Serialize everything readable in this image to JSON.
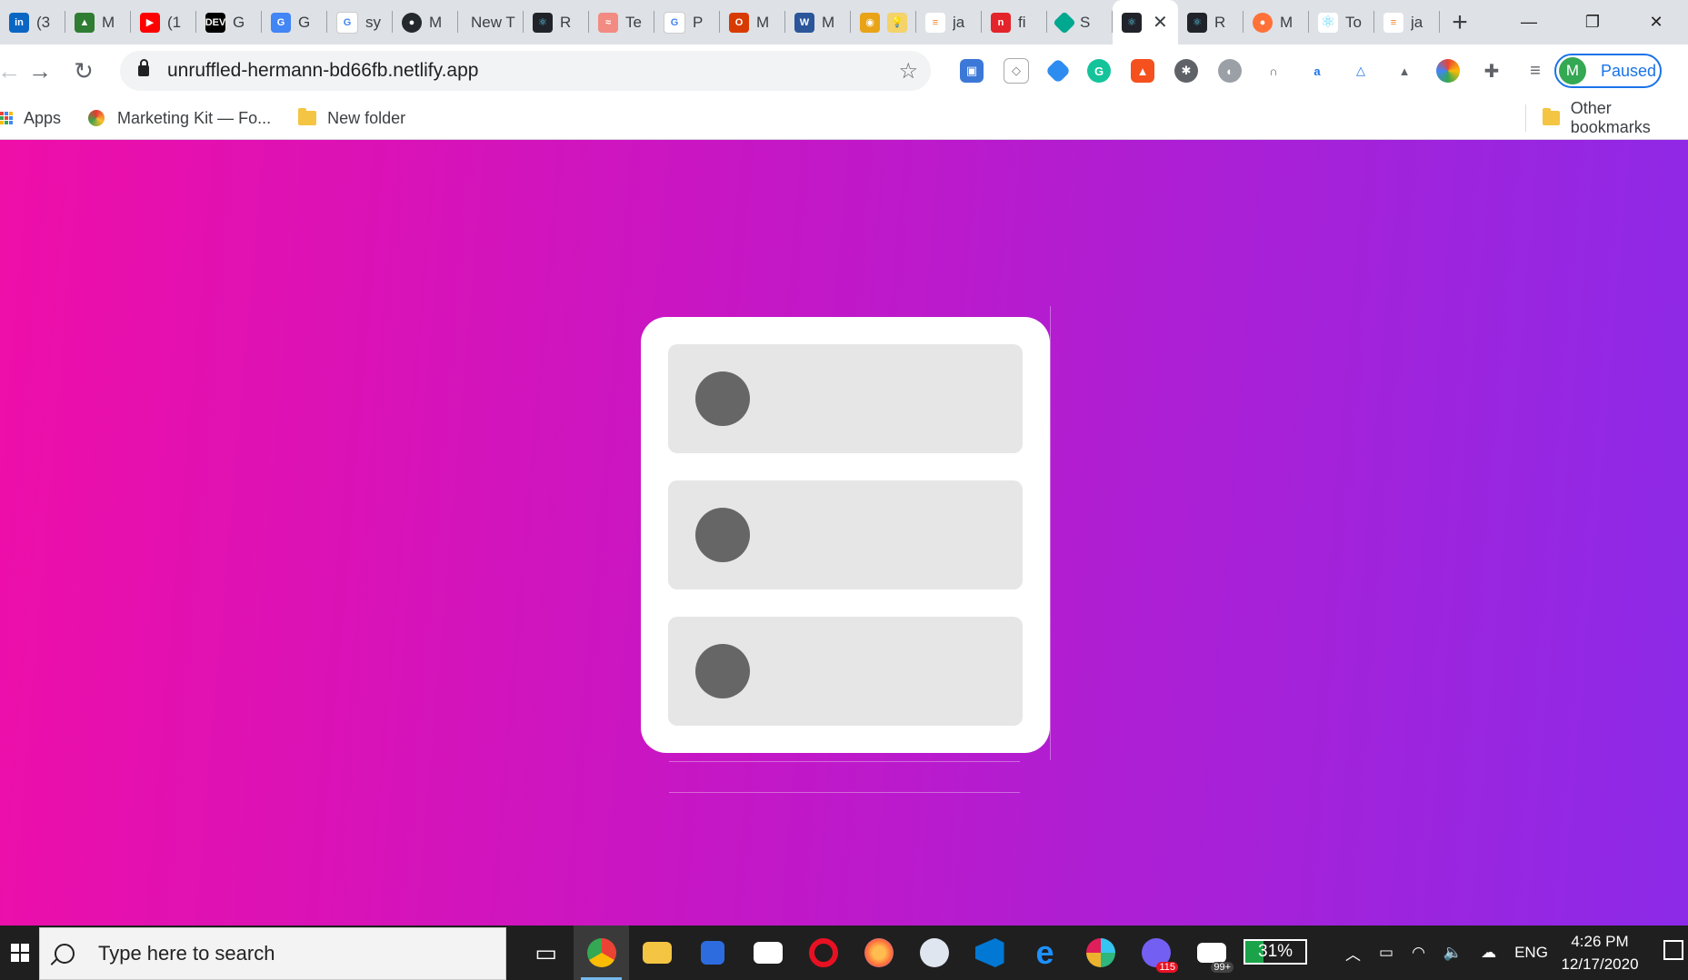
{
  "browser": {
    "tabs": [
      {
        "label": "(3",
        "icon": "linkedin-icon",
        "color": "#0a66c2"
      },
      {
        "label": "M",
        "icon": "tree-icon",
        "color": "#2e7d32"
      },
      {
        "label": "(1",
        "icon": "youtube-icon",
        "color": "#ff0000"
      },
      {
        "label": "G",
        "icon": "dev-icon",
        "color": "#000000"
      },
      {
        "label": "G",
        "icon": "google-translate-icon",
        "color": "#4285f4"
      },
      {
        "label": "sy",
        "icon": "google-icon",
        "color": "#4285f4"
      },
      {
        "label": "M",
        "icon": "github-icon",
        "color": "#24292e"
      },
      {
        "label": "New T",
        "icon": "",
        "color": ""
      },
      {
        "label": "R",
        "icon": "react-icon",
        "color": "#20232a"
      },
      {
        "label": "Te",
        "icon": "wave-icon",
        "color": "#f28b82"
      },
      {
        "label": "P",
        "icon": "google-icon",
        "color": "#4285f4"
      },
      {
        "label": "M",
        "icon": "office-icon",
        "color": "#d83b01"
      },
      {
        "label": "M",
        "icon": "word-icon",
        "color": "#2b579a"
      },
      {
        "label": "",
        "icon": "badge-icon",
        "color": "#e8a317"
      },
      {
        "label": "ja",
        "icon": "stackoverflow-icon",
        "color": "#f48024"
      },
      {
        "label": "fi",
        "icon": "netlify-n-icon",
        "color": "#e3242b"
      },
      {
        "label": "S",
        "icon": "diamond-icon",
        "color": "#00a88f"
      },
      {
        "label": "",
        "icon": "react-icon",
        "color": "#20232a",
        "active": true
      },
      {
        "label": "R",
        "icon": "react-icon",
        "color": "#20232a"
      },
      {
        "label": "M",
        "icon": "firefox-icon",
        "color": "#ff7139"
      },
      {
        "label": "To",
        "icon": "react-icon",
        "color": "#61dafb"
      },
      {
        "label": "ja",
        "icon": "stackoverflow-icon",
        "color": "#f48024"
      }
    ],
    "new_tab_symbol": "+",
    "window_controls": {
      "minimize": "—",
      "restore": "❐",
      "close": "✕"
    },
    "nav": {
      "back": "←",
      "forward": "→",
      "reload": "↻"
    },
    "url": "unruffled-hermann-bd66fb.netlify.app",
    "star_symbol": "☆",
    "profile": {
      "initial": "M",
      "status": "Paused"
    },
    "bookmarks": {
      "apps": "Apps",
      "items": [
        "Marketing Kit — Fo...",
        "New folder"
      ],
      "other": "Other bookmarks"
    }
  },
  "page": {
    "card_items": 3
  },
  "taskbar": {
    "search_placeholder": "Type here to search",
    "battery": "31%",
    "language": "ENG",
    "time": "4:26 PM",
    "date": "12/17/2020",
    "badges": {
      "viber": "115",
      "mail": "99+"
    }
  }
}
